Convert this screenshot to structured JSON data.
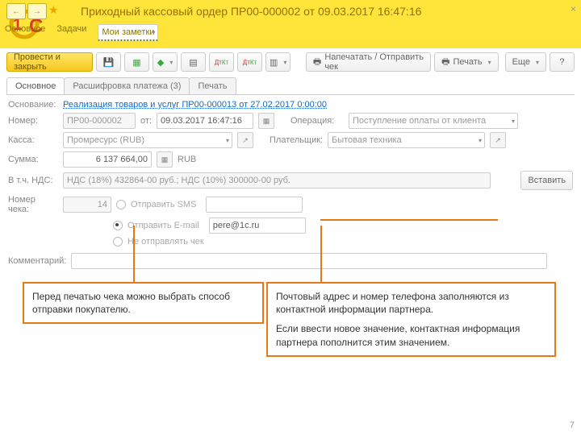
{
  "header": {
    "title": "Приходный кассовый ордер ПР00-000002 от 09.03.2017 16:47:16",
    "nav": {
      "main": "Основное",
      "tasks": "Задачи",
      "notes": "Мои заметки"
    },
    "close": "×"
  },
  "toolbar": {
    "post_close": "Провести и закрыть",
    "print_check": "Напечатать / Отправить чек",
    "print": "Печать",
    "more": "Еще",
    "help": "?"
  },
  "tabs": {
    "main": "Основное",
    "detail": "Расшифровка платежа (3)",
    "print": "Печать"
  },
  "form": {
    "basis_label": "Основание:",
    "basis_link": "Реализация товаров и услуг ПР00-000013 от 27.02.2017 0:00:00",
    "number_label": "Номер:",
    "number": "ПР00-000002",
    "from_label": "от:",
    "date": "09.03.2017 16:47:16",
    "operation_label": "Операция:",
    "operation": "Поступление оплаты от клиента",
    "kassa_label": "Касса:",
    "kassa": "Промресурс (RUB)",
    "payer_label": "Плательщик:",
    "payer": "Бытовая техника",
    "sum_label": "Сумма:",
    "sum": "6 137 664,00",
    "currency": "RUB",
    "vat_label": "В т.ч. НДС:",
    "vat": "НДС (18%) 432864-00 руб.; НДС (10%) 300000-00 руб.",
    "insert": "Вставить",
    "check_label": "Номер чека:",
    "check_no": "14",
    "send_sms": "Отправить SMS",
    "sms_value": "",
    "send_email": "Отправить E-mail",
    "email_value": "pere@1c.ru",
    "no_send": "Не отправлять чек",
    "comment_label": "Комментарий:"
  },
  "callouts": {
    "left": "Перед печатью чека можно выбрать способ отправки покупателю.",
    "right1": "Почтовый адрес и номер телефона заполняются из контактной информации партнера.",
    "right2": "Если ввести новое значение, контактная информация партнера пополнится этим значением."
  },
  "page": "7"
}
